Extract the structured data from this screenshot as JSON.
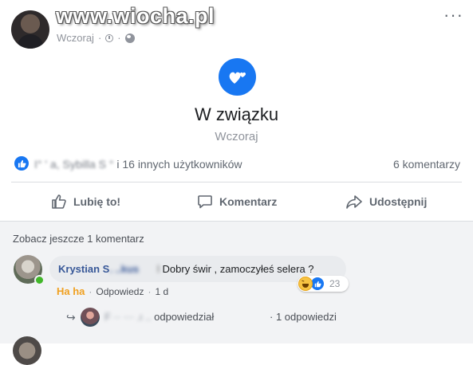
{
  "post": {
    "watermark": "www.wiocha.pl",
    "time": "Wczoraj",
    "time_separator": "·",
    "more_label": "···",
    "life_event": {
      "title": "W związku",
      "date": "Wczoraj"
    },
    "reactions": {
      "names_blurred": "I° ' a, Sybilla S ° ",
      "names_tail": "i 16 innych użytkowników",
      "comments_count": "6 komentarzy"
    },
    "actions": {
      "like": "Lubię to!",
      "comment": "Komentarz",
      "share": "Udostępnij"
    }
  },
  "comments": {
    "see_more": "Zobacz jeszcze 1 komentarz",
    "items": [
      {
        "author_visible": "Krystian S",
        "author_blurred": ". ..kus",
        "text_blurred": "l",
        "text": "Dobry świr , zamoczyłeś selera ?",
        "reaction_count": "23",
        "actions": {
          "reaction": "Ha ha",
          "reply": "Odpowiedz",
          "time": "1 d",
          "separator": "·"
        },
        "replies": {
          "arrow": "↪",
          "author_blurred": "F ·· ··· .ı ..",
          "summary": "odpowiedział",
          "separator": "·",
          "count": "1 odpowiedzi"
        }
      }
    ]
  },
  "colors": {
    "accent": "#1877f2",
    "link": "#385898",
    "haha": "#f0a020",
    "muted": "#90949c"
  },
  "icons": [
    "clock-icon",
    "globe-icon",
    "more-icon",
    "heart-icon",
    "like-icon",
    "comment-icon",
    "share-icon",
    "haha-icon",
    "reply-arrow-icon"
  ]
}
